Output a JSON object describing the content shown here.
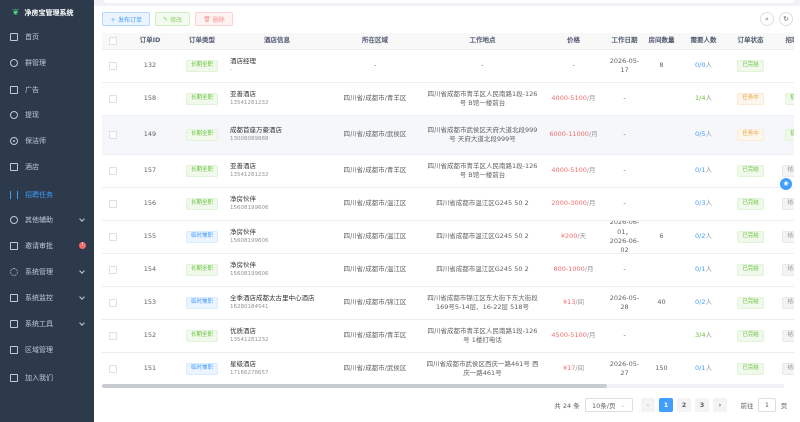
{
  "app": {
    "title": "净房宝管理系统"
  },
  "sidebar": {
    "items": [
      {
        "label": "首页",
        "icon": "home-icon"
      },
      {
        "label": "群管理",
        "icon": "group-icon"
      },
      {
        "label": "广告",
        "icon": "ad-icon"
      },
      {
        "label": "提现",
        "icon": "withdraw-icon"
      },
      {
        "label": "保洁师",
        "icon": "cleaner-icon"
      },
      {
        "label": "酒店",
        "icon": "hotel-icon"
      },
      {
        "label": "招聘任务",
        "icon": "recruit-icon",
        "active": true
      },
      {
        "label": "其他辅助",
        "icon": "assist-icon"
      },
      {
        "label": "邀请审批",
        "icon": "approval-icon",
        "badge": "!"
      },
      {
        "label": "系统管理",
        "icon": "gear-icon"
      },
      {
        "label": "系统监控",
        "icon": "monitor-icon"
      },
      {
        "label": "系统工具",
        "icon": "tools-icon"
      },
      {
        "label": "区域管理",
        "icon": "region-icon"
      },
      {
        "label": "加入我们",
        "icon": "join-icon"
      }
    ]
  },
  "toolbar": {
    "add_label": "发布订单",
    "edit_label": "修改",
    "delete_label": "删除"
  },
  "table": {
    "headers": [
      "订单ID",
      "订单类型",
      "酒店信息",
      "所在区域",
      "工作地点",
      "价格",
      "工作日期",
      "房间数量",
      "需要人数",
      "订单状态",
      "招聘状态"
    ],
    "rows": [
      {
        "id": "132",
        "type": "长期全职",
        "type_color": "green",
        "hotel": "酒店经理",
        "phone": "-",
        "region": "-",
        "location": "-",
        "price": "-",
        "unit": "",
        "date": "2026-05-17",
        "rooms": "8",
        "need": "0/0",
        "need_unit": "人",
        "need_color": "blue",
        "status": "已完结",
        "status_color": "green",
        "recruit": "-",
        "recruit_color": ""
      },
      {
        "id": "158",
        "type": "长期全职",
        "type_color": "green",
        "hotel": "亚善酒店",
        "phone": "13541281232",
        "region": "四川省/成都市/青羊区",
        "location": "四川省成都市青羊区人民南路1段-126号 B馆一楼前台",
        "price": "4000-5100",
        "unit": "/月",
        "date": "-",
        "rooms": "",
        "need": "1/4",
        "need_unit": "人",
        "need_color": "green",
        "status": "任务中",
        "status_color": "orange",
        "recruit": "招聘中",
        "recruit_color": "green"
      },
      {
        "id": "149",
        "type": "长期全职",
        "type_color": "green",
        "hotel": "成都首座万豪酒店",
        "phone": "13008089888",
        "region": "四川省/成都市/武侯区",
        "location": "四川省成都市武侯区天府大道北段999号 天府大道北段999号",
        "price": "6000-11000",
        "unit": "/月",
        "date": "-",
        "rooms": "",
        "need": "0/5",
        "need_unit": "人",
        "need_color": "blue",
        "status": "任务中",
        "status_color": "orange",
        "recruit": "招聘中",
        "recruit_color": "green"
      },
      {
        "id": "157",
        "type": "长期全职",
        "type_color": "green",
        "hotel": "亚善酒店",
        "phone": "13541281232",
        "region": "四川省/成都市/青羊区",
        "location": "四川省成都市青羊区人民南路1段-126号 B馆一楼前台",
        "price": "4000-5100",
        "unit": "/月",
        "date": "-",
        "rooms": "",
        "need": "0/1",
        "need_unit": "人",
        "need_color": "blue",
        "status": "已完结",
        "status_color": "green",
        "recruit": "结束招聘",
        "recruit_color": "gray"
      },
      {
        "id": "156",
        "type": "长期全职",
        "type_color": "green",
        "hotel": "净房伙伴",
        "phone": "15608199606",
        "region": "四川省/成都市/温江区",
        "location": "四川省成都市温江区G245 50 2",
        "price": "2000-3000",
        "unit": "/月",
        "date": "-",
        "rooms": "",
        "need": "0/3",
        "need_unit": "人",
        "need_color": "blue",
        "status": "已完结",
        "status_color": "green",
        "recruit": "结束招聘",
        "recruit_color": "gray"
      },
      {
        "id": "155",
        "type": "临时兼职",
        "type_color": "blue",
        "hotel": "净房伙伴",
        "phone": "15608199606",
        "region": "四川省/成都市/温江区",
        "location": "四川省成都市温江区G245 50 2",
        "price": "¥200",
        "unit": "/天",
        "date": "2026-06-01，2026-06-02",
        "rooms": "6",
        "need": "0/2",
        "need_unit": "人",
        "need_color": "blue",
        "status": "已完结",
        "status_color": "green",
        "recruit": "结束招聘",
        "recruit_color": "gray"
      },
      {
        "id": "154",
        "type": "长期全职",
        "type_color": "green",
        "hotel": "净房伙伴",
        "phone": "15608199606",
        "region": "四川省/成都市/温江区",
        "location": "四川省成都市温江区G245 50 2",
        "price": "800-1000",
        "unit": "/月",
        "date": "-",
        "rooms": "",
        "need": "0/1",
        "need_unit": "人",
        "need_color": "blue",
        "status": "已完结",
        "status_color": "green",
        "recruit": "结束招聘",
        "recruit_color": "gray"
      },
      {
        "id": "153",
        "type": "临时兼职",
        "type_color": "blue",
        "hotel": "全季酒店成都太古里中心酒店",
        "phone": "16280184541",
        "region": "四川省/成都市/锦江区",
        "location": "四川省成都市锦江区东大街下东大街段169号5-14层、16-22层 518号",
        "price": "¥13",
        "unit": "/间",
        "date": "2026-05-28",
        "rooms": "40",
        "need": "0/2",
        "need_unit": "人",
        "need_color": "blue",
        "status": "已完结",
        "status_color": "green",
        "recruit": "结束招聘",
        "recruit_color": "gray"
      },
      {
        "id": "152",
        "type": "长期全职",
        "type_color": "green",
        "hotel": "优质酒店",
        "phone": "13541281232",
        "region": "四川省/成都市/青羊区",
        "location": "四川省成都市青羊区人民南路1段-126号 1楼打电话",
        "price": "4500-5100",
        "unit": "/月",
        "date": "-",
        "rooms": "",
        "need": "3/4",
        "need_unit": "人",
        "need_color": "green",
        "status": "已完结",
        "status_color": "green",
        "recruit": "结束招聘",
        "recruit_color": "gray"
      },
      {
        "id": "151",
        "type": "临时兼职",
        "type_color": "blue",
        "hotel": "星级酒店",
        "phone": "17166278657",
        "region": "四川省/成都市/武侯区",
        "location": "四川省成都市武侯区西庆一路461号 西庆一路461号",
        "price": "¥17",
        "unit": "/间",
        "date": "2026-05-27",
        "rooms": "150",
        "need": "0/1",
        "need_unit": "人",
        "need_color": "blue",
        "status": "已完结",
        "status_color": "green",
        "recruit": "结束招聘",
        "recruit_color": "gray"
      }
    ]
  },
  "pagination": {
    "total": "共 24 条",
    "page_size": "10条/页",
    "pages": [
      "1",
      "2",
      "3"
    ],
    "current": "1",
    "goto_label": "前往",
    "goto_value": "1",
    "page_unit": "页"
  },
  "colors": {
    "primary": "#409eff",
    "sidebar_bg": "#2d3a4b",
    "success": "#67c23a",
    "warning": "#e6a23c",
    "danger": "#f56c6c"
  }
}
